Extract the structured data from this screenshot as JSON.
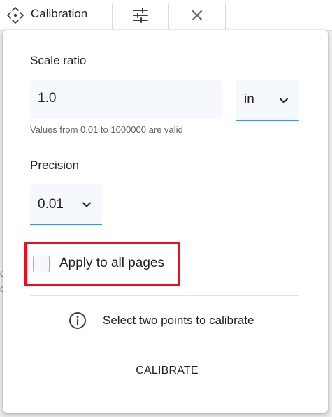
{
  "toolbar": {
    "title": "Calibration",
    "icons": [
      "move-icon",
      "sliders-icon",
      "close-icon"
    ]
  },
  "background": {
    "edge_text": [
      "o",
      "o"
    ]
  },
  "panel": {
    "scale_ratio_label": "Scale ratio",
    "scale_ratio_value": "1.0",
    "unit_value": "in",
    "hint": "Values from 0.01 to 1000000 are valid",
    "precision_label": "Precision",
    "precision_value": "0.01",
    "apply_all_label": "Apply to all pages",
    "apply_all_checked": false,
    "info_text": "Select two points to calibrate",
    "calibrate_label": "CALIBRATE"
  },
  "colors": {
    "highlight": "#e8101a",
    "field_bg": "#f5f9fe",
    "field_underline": "#4a8fd0"
  }
}
